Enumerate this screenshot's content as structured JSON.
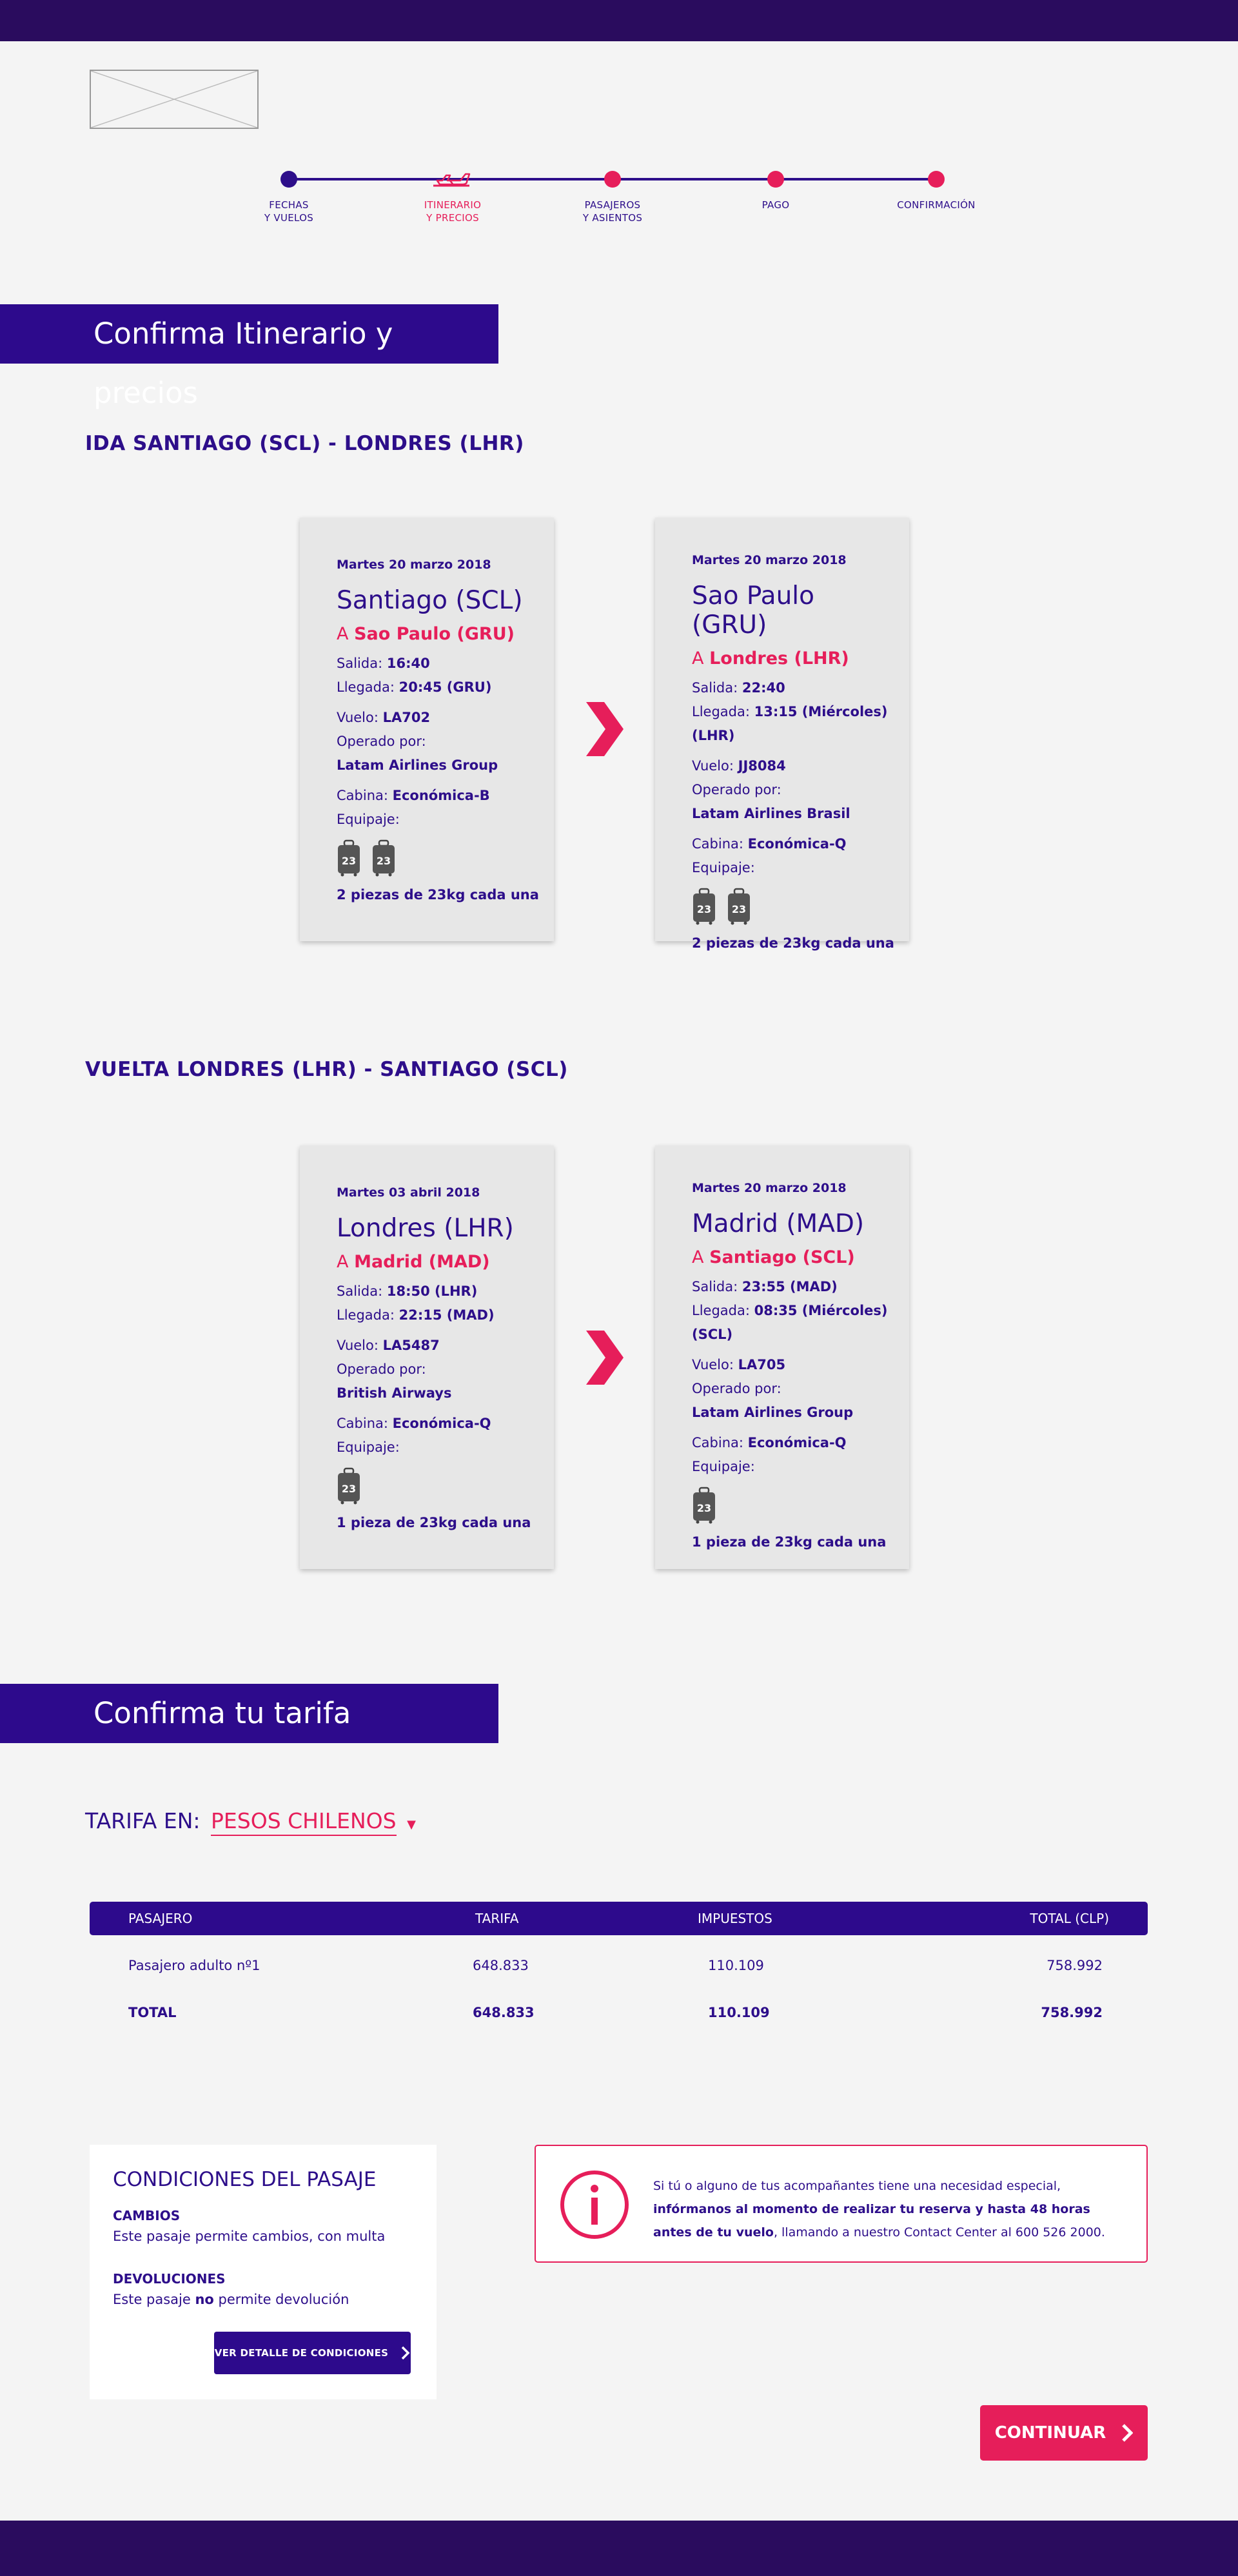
{
  "stepper": {
    "steps": [
      {
        "label1": "FECHAS",
        "label2": "Y VUELOS"
      },
      {
        "label1": "ITINERARIO",
        "label2": "Y PRECIOS"
      },
      {
        "label1": "PASAJEROS",
        "label2": "Y ASIENTOS"
      },
      {
        "label1": "PAGO",
        "label2": ""
      },
      {
        "label1": "CONFIRMACIÓN",
        "label2": ""
      }
    ],
    "current_step": 2
  },
  "section1": {
    "title": "Confirma Itinerario y precios"
  },
  "ida": {
    "title": "IDA SANTIAGO (SCL) - LONDRES (LHR)",
    "cards": [
      {
        "date": "Martes 20 marzo 2018",
        "city": "Santiago (SCL)",
        "to_prefix": "A",
        "to": "Sao Paulo (GRU)",
        "salida_label": "Salida:",
        "salida": "16:40",
        "llegada_label": "Llegada:",
        "llegada": "20:45 (GRU)",
        "vuelo_label": "Vuelo:",
        "vuelo": "LA702",
        "operado_label": "Operado por:",
        "operado": "Latam Airlines Group",
        "cabina_label": "Cabina:",
        "cabina": "Económica-B",
        "equipaje_label": "Equipaje:",
        "bags": [
          "23",
          "23"
        ],
        "pieces": "2 piezas de 23kg cada una"
      },
      {
        "date": "Martes 20 marzo 2018",
        "city": "Sao Paulo (GRU)",
        "to_prefix": "A",
        "to": "Londres (LHR)",
        "salida_label": "Salida:",
        "salida": "22:40",
        "llegada_label": "Llegada:",
        "llegada": "13:15 (Miércoles) (LHR)",
        "vuelo_label": "Vuelo:",
        "vuelo": "JJ8084",
        "operado_label": "Operado por:",
        "operado": "Latam Airlines Brasil",
        "cabina_label": "Cabina:",
        "cabina": "Económica-Q",
        "equipaje_label": "Equipaje:",
        "bags": [
          "23",
          "23"
        ],
        "pieces": "2 piezas de 23kg cada una"
      }
    ]
  },
  "vuelta": {
    "title": "VUELTA LONDRES (LHR) - SANTIAGO (SCL)",
    "cards": [
      {
        "date": "Martes 03 abril 2018",
        "city": "Londres (LHR)",
        "to_prefix": "A",
        "to": "Madrid (MAD)",
        "salida_label": "Salida:",
        "salida": "18:50 (LHR)",
        "llegada_label": "Llegada:",
        "llegada": "22:15 (MAD)",
        "vuelo_label": "Vuelo:",
        "vuelo": "LA5487",
        "operado_label": "Operado por:",
        "operado": "British Airways",
        "cabina_label": "Cabina:",
        "cabina": "Económica-Q",
        "equipaje_label": "Equipaje:",
        "bags": [
          "23"
        ],
        "pieces": "1 pieza de 23kg cada una"
      },
      {
        "date": "Martes 20 marzo 2018",
        "city": "Madrid (MAD)",
        "to_prefix": "A",
        "to": "Santiago (SCL)",
        "salida_label": "Salida:",
        "salida": "23:55 (MAD)",
        "llegada_label": "Llegada:",
        "llegada": "08:35 (Miércoles) (SCL)",
        "vuelo_label": "Vuelo:",
        "vuelo": "LA705",
        "operado_label": "Operado por:",
        "operado": "Latam Airlines Group",
        "cabina_label": "Cabina:",
        "cabina": "Económica-Q",
        "equipaje_label": "Equipaje:",
        "bags": [
          "23"
        ],
        "pieces": "1 pieza de 23kg cada una"
      }
    ]
  },
  "section2": {
    "title": "Confirma tu tarifa"
  },
  "tarifa": {
    "label": "TARIFA EN:",
    "currency": "PESOS CHILENOS"
  },
  "table": {
    "headers": [
      "PASAJERO",
      "TARIFA",
      "IMPUESTOS",
      "TOTAL (CLP)"
    ],
    "rows": [
      [
        "Pasajero adulto nº1",
        "648.833",
        "110.109",
        "758.992"
      ],
      [
        "TOTAL",
        "648.833",
        "110.109",
        "758.992"
      ]
    ]
  },
  "conditions": {
    "title": "CONDICIONES DEL PASAJE",
    "cambios_title": "CAMBIOS",
    "cambios_text": "Este pasaje permite cambios, con multa",
    "devol_title": "DEVOLUCIONES",
    "devol_pre": "Este pasaje ",
    "devol_bold": "no",
    "devol_post": " permite devolución",
    "button": "VER DETALLE DE CONDICIONES"
  },
  "info": {
    "pre": "Si tú o alguno de tus acompañantes tiene una necesidad especial, ",
    "bold": "infórmanos al momento de realizar tu reserva y hasta 48 horas antes de tu vuelo",
    "post": ", llamando a nuestro Contact Center al 600 526 2000."
  },
  "cta": {
    "label": "CONTINUAR"
  },
  "colors": {
    "primary": "#2d0a8c",
    "accent": "#e61e5a",
    "bar": "#2a0c5e"
  }
}
